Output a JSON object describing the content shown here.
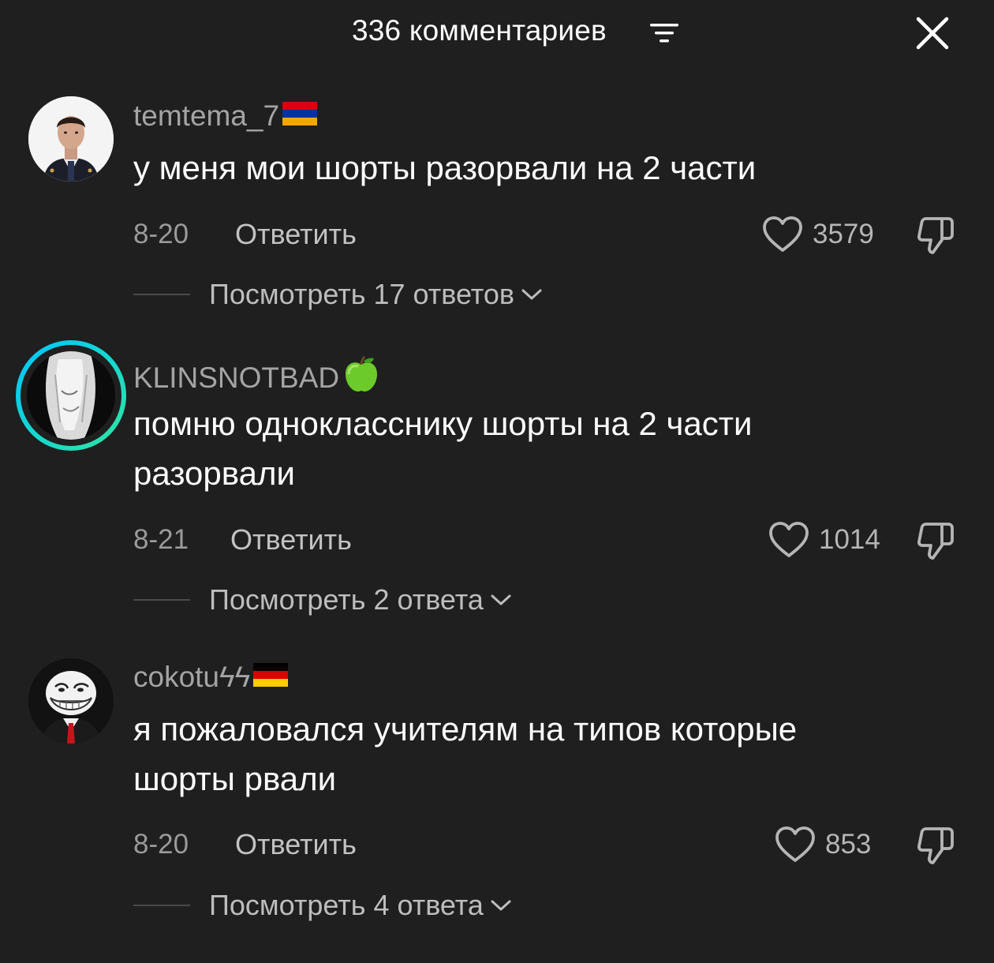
{
  "header": {
    "title": "336 комментариев",
    "filter_icon": "filter-lines-icon",
    "close_icon": "close-icon"
  },
  "comments": [
    {
      "username": "temtema_7",
      "flag": "armenia-flag",
      "text": "у меня мои шорты разорвали на 2 части",
      "date": "8-20",
      "reply_label": "Ответить",
      "likes": "3579",
      "view_replies": "Посмотреть 17 ответов"
    },
    {
      "username": "KLINSNOTBAD",
      "flag": "green-apple-emoji",
      "text": "помню однокласснику шорты на 2 части разорвали",
      "date": "8-21",
      "reply_label": "Ответить",
      "likes": "1014",
      "view_replies": "Посмотреть 2 ответа"
    },
    {
      "username": "cokotuϟϟ",
      "flag": "germany-flag",
      "text": "я пожаловался учителям на типов которые шорты рвали",
      "date": "8-20",
      "reply_label": "Ответить",
      "likes": "853",
      "view_replies": "Посмотреть 4 ответа"
    }
  ],
  "colors": {
    "background": "#1f1f1f",
    "text_primary": "#ffffff",
    "text_secondary": "#a4a4a4",
    "story_ring_start": "#00c6ff",
    "story_ring_end": "#2ee6a0"
  }
}
